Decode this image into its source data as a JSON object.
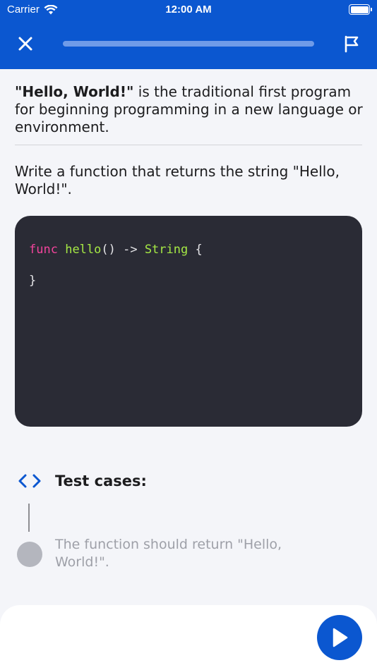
{
  "status_bar": {
    "carrier": "Carrier",
    "time": "12:00 AM"
  },
  "nav": {
    "progress": 1.0,
    "close_icon": "close-icon",
    "flag_icon": "flag-icon"
  },
  "lesson": {
    "intro_bold": "\"Hello, World!\"",
    "intro_rest": " is the traditional first program for beginning programming in a new language or environment.",
    "task": "Write a function that returns the string \"Hello, World!\"."
  },
  "code": {
    "keyword": "func",
    "function_name": "hello",
    "signature": "() -> ",
    "return_type": "String",
    "open_brace": " {",
    "close_brace": "}"
  },
  "tests": {
    "title": "Test cases:",
    "items": [
      {
        "text": "The function should return \"Hello, World!\"."
      }
    ]
  },
  "colors": {
    "brand": "#0b57d0",
    "editor_bg": "#2a2b35",
    "keyword": "#f0449b",
    "identifier": "#a5e844"
  },
  "run_button": {
    "icon": "play-icon"
  }
}
